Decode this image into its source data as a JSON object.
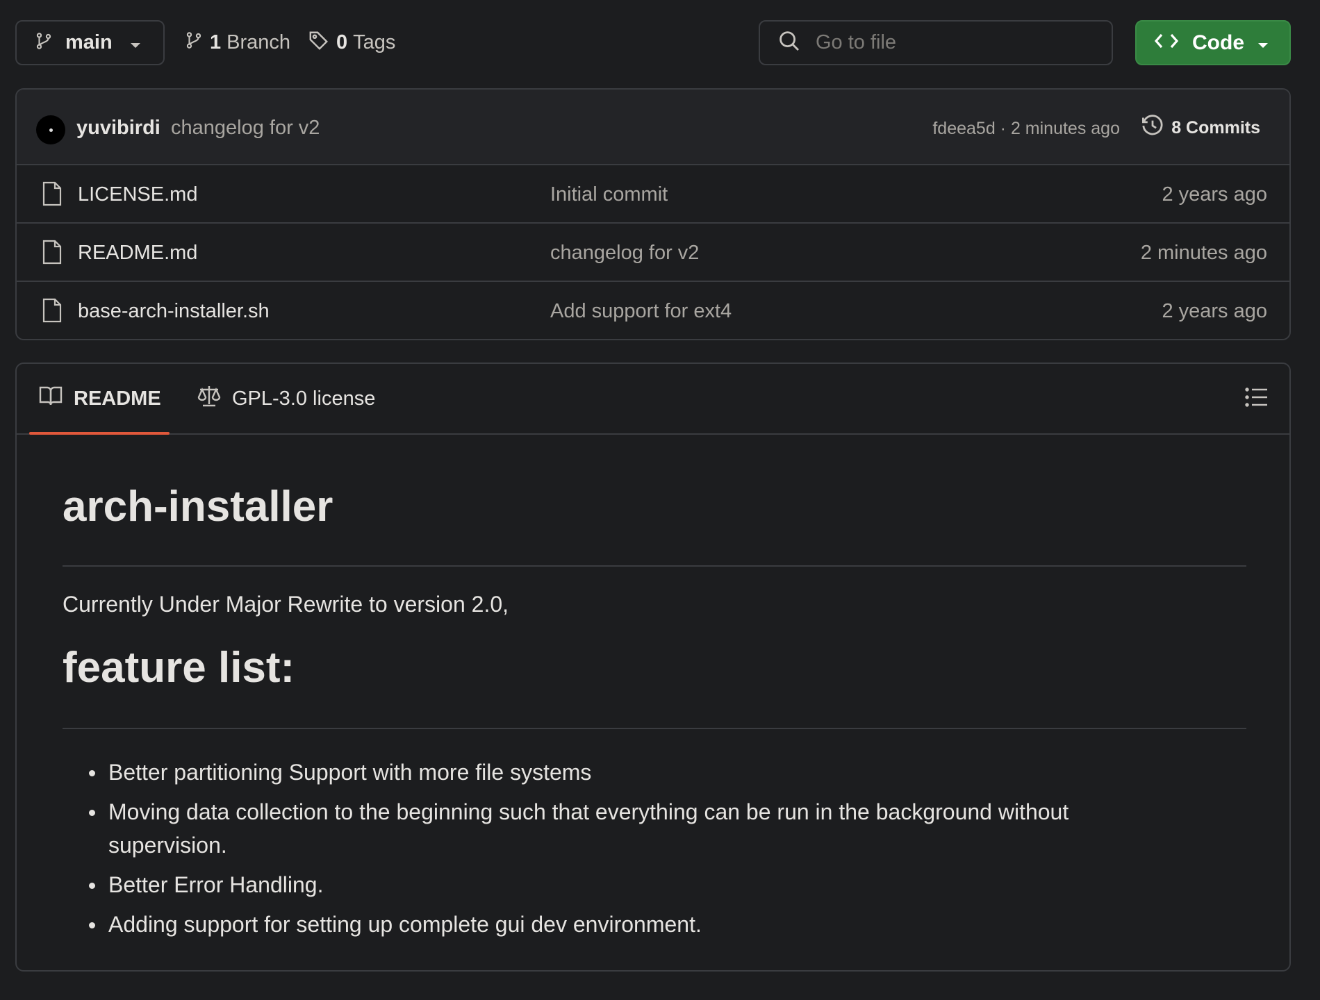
{
  "toolbar": {
    "branch_name": "main",
    "branches_count": "1",
    "branches_label": "Branch",
    "tags_count": "0",
    "tags_label": "Tags",
    "search_placeholder": "Go to file",
    "code_label": "Code",
    "accent_color": "#2e7d3a"
  },
  "latest_commit": {
    "author": "yuvibirdi",
    "message": "changelog for v2",
    "hash_and_time": "fdeea5d · 2 minutes ago",
    "commits_label": "8 Commits"
  },
  "files": [
    {
      "name": "LICENSE.md",
      "commit": "Initial commit",
      "age": "2 years ago"
    },
    {
      "name": "README.md",
      "commit": "changelog for v2",
      "age": "2 minutes ago"
    },
    {
      "name": "base-arch-installer.sh",
      "commit": "Add support for ext4",
      "age": "2 years ago"
    }
  ],
  "readme": {
    "tabs": [
      {
        "label": "README",
        "icon": "book-icon",
        "active": true
      },
      {
        "label": "GPL-3.0 license",
        "icon": "scale-icon",
        "active": false
      }
    ],
    "active_tab_color": "#e0583b",
    "title": "arch-installer",
    "intro": "Currently Under Major Rewrite to version 2.0,",
    "features_heading": "feature list:",
    "features": [
      "Better partitioning Support with more file systems",
      "Moving data collection to the beginning such that everything can be run in the background without supervision.",
      "Better Error Handling.",
      "Adding support for setting up complete gui dev environment."
    ]
  }
}
